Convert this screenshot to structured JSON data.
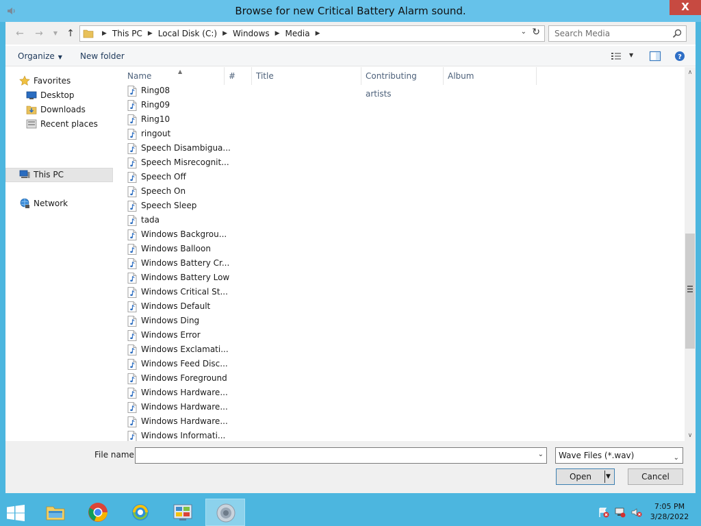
{
  "window": {
    "title": "Browse for new Critical Battery Alarm sound.",
    "close_label": "X"
  },
  "address": {
    "crumbs": [
      "This PC",
      "Local Disk (C:)",
      "Windows",
      "Media"
    ]
  },
  "search": {
    "placeholder": "Search Media"
  },
  "toolbar": {
    "organize_label": "Organize",
    "new_folder_label": "New folder"
  },
  "nav": {
    "favorites": "Favorites",
    "desktop": "Desktop",
    "downloads": "Downloads",
    "recent_places": "Recent places",
    "this_pc": "This PC",
    "network": "Network"
  },
  "columns": [
    "Name",
    "#",
    "Title",
    "Contributing artists",
    "Album"
  ],
  "files": [
    "Ring08",
    "Ring09",
    "Ring10",
    "ringout",
    "Speech Disambigua...",
    "Speech Misrecognit...",
    "Speech Off",
    "Speech On",
    "Speech Sleep",
    "tada",
    "Windows Backgrou...",
    "Windows Balloon",
    "Windows Battery Cr...",
    "Windows Battery Low",
    "Windows Critical St...",
    "Windows Default",
    "Windows Ding",
    "Windows Error",
    "Windows Exclamati...",
    "Windows Feed Disc...",
    "Windows Foreground",
    "Windows Hardware...",
    "Windows Hardware...",
    "Windows Hardware...",
    "Windows Informati..."
  ],
  "bottom": {
    "file_name_label": "File name:",
    "file_name_value": "",
    "filter_value": "Wave Files (*.wav)",
    "open_label": "Open",
    "cancel_label": "Cancel"
  },
  "taskbar": {
    "time": "7:05 PM",
    "date": "3/28/2022"
  },
  "colors": {
    "titlebar": "#66c2ea",
    "taskbar": "#4cb6df",
    "close": "#c74a41"
  }
}
